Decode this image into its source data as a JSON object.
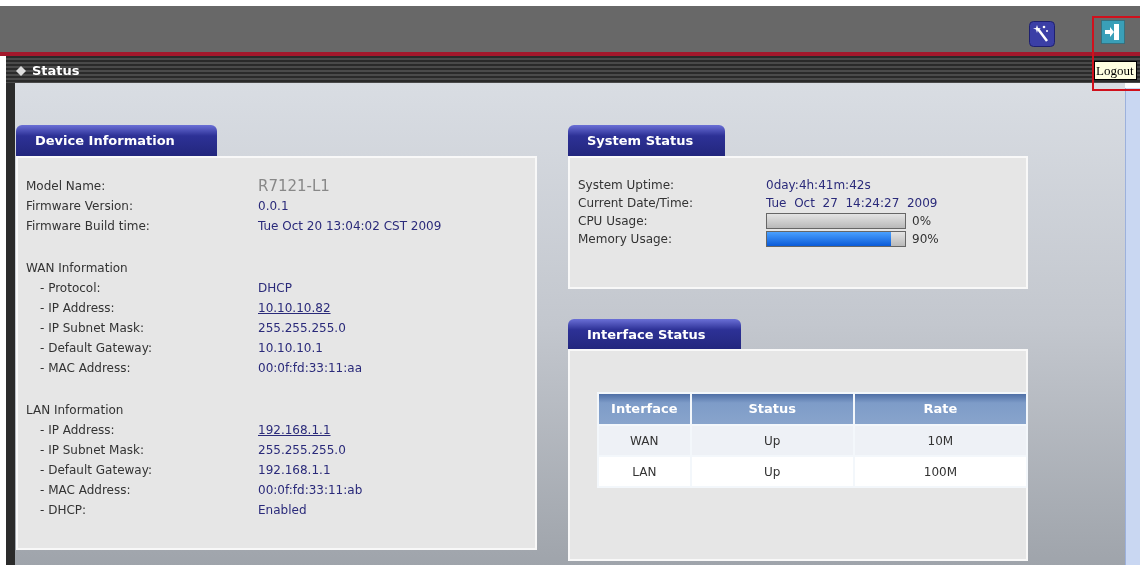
{
  "header": {
    "logout_tooltip": "Logout"
  },
  "page_title": "Status",
  "device_information": {
    "title": "Device Information",
    "groups": [
      {
        "rows": [
          {
            "label": "Model Name:",
            "value": "R7121-L1",
            "kind": "model"
          },
          {
            "label": "Firmware Version:",
            "value": "0.0.1",
            "kind": "text"
          },
          {
            "label": "Firmware Build time:",
            "value": "Tue Oct 20 13:04:02 CST 2009",
            "kind": "text"
          }
        ]
      },
      {
        "heading": "WAN Information",
        "rows": [
          {
            "label": "- Protocol:",
            "value": "DHCP",
            "kind": "text"
          },
          {
            "label": "- IP Address:",
            "value": "10.10.10.82",
            "kind": "link"
          },
          {
            "label": "- IP Subnet Mask:",
            "value": "255.255.255.0",
            "kind": "text"
          },
          {
            "label": "- Default Gateway:",
            "value": "10.10.10.1",
            "kind": "text"
          },
          {
            "label": "- MAC Address:",
            "value": "00:0f:fd:33:11:aa",
            "kind": "text"
          }
        ]
      },
      {
        "heading": "LAN Information",
        "rows": [
          {
            "label": "- IP Address:",
            "value": "192.168.1.1",
            "kind": "link"
          },
          {
            "label": "- IP Subnet Mask:",
            "value": "255.255.255.0",
            "kind": "text"
          },
          {
            "label": "- Default Gateway:",
            "value": "192.168.1.1",
            "kind": "text"
          },
          {
            "label": "- MAC Address:",
            "value": "00:0f:fd:33:11:ab",
            "kind": "text"
          },
          {
            "label": "- DHCP:",
            "value": "Enabled",
            "kind": "text"
          }
        ]
      }
    ]
  },
  "system_status": {
    "title": "System Status",
    "rows": [
      {
        "label": "System Uptime:",
        "kind": "text",
        "value": "0day:4h:41m:42s"
      },
      {
        "label": "Current Date/Time:",
        "kind": "text",
        "value": "Tue  Oct  27  14:24:27  2009"
      },
      {
        "label": "CPU Usage:",
        "kind": "meter",
        "level": 0,
        "reading": "0%"
      },
      {
        "label": "Memory Usage:",
        "kind": "meter",
        "level": 0.9,
        "reading": "90%"
      }
    ]
  },
  "interface_status": {
    "title": "Interface Status",
    "columns": [
      "Interface",
      "Status",
      "Rate"
    ],
    "rows": [
      [
        "WAN",
        "Up",
        "10M"
      ],
      [
        "LAN",
        "Up",
        "100M"
      ]
    ]
  }
}
